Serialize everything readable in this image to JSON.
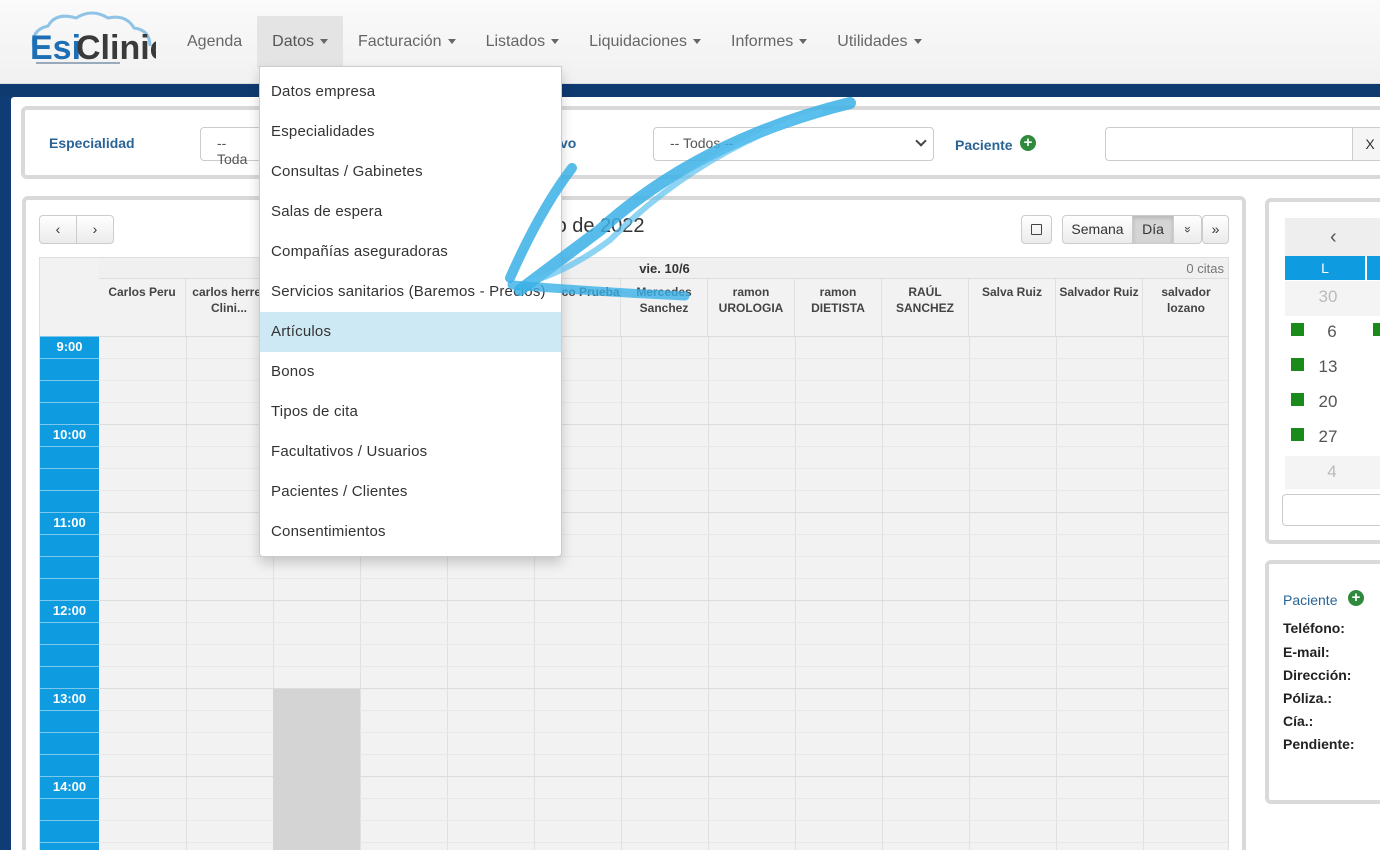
{
  "nav": {
    "items": [
      {
        "label": "Agenda",
        "dropdown": false
      },
      {
        "label": "Datos",
        "dropdown": true
      },
      {
        "label": "Facturación",
        "dropdown": true
      },
      {
        "label": "Listados",
        "dropdown": true
      },
      {
        "label": "Liquidaciones",
        "dropdown": true
      },
      {
        "label": "Informes",
        "dropdown": true
      },
      {
        "label": "Utilidades",
        "dropdown": true
      }
    ],
    "active": "Datos"
  },
  "dropdown": {
    "items": [
      "Datos empresa",
      "Especialidades",
      "Consultas / Gabinetes",
      "Salas de espera",
      "Compañías aseguradoras",
      "Servicios sanitarios (Baremos - Precios)",
      "Artículos",
      "Bonos",
      "Tipos de cita",
      "Facultativos / Usuarios",
      "Pacientes / Clientes",
      "Consentimientos"
    ],
    "highlighted": "Artículos"
  },
  "filters": {
    "especialidad_label": "Especialidad",
    "especialidad_value": "-- Toda",
    "motivo_label_partial": "vo",
    "motivo_value": "-- Todos --",
    "paciente_label": "Paciente",
    "clear_button": "X"
  },
  "calendar": {
    "prev": "‹",
    "next": "›",
    "title_partial": "nio de 2022",
    "note_icon": "note-icon",
    "view_week": "Semana",
    "view_day": "Día",
    "more": "»",
    "expand": "»",
    "day_header": "vie. 10/6",
    "count": "0 citas",
    "columns": [
      "Carlos Peru",
      "carlos herrer Clini...",
      "",
      "",
      "",
      "Medico Prueba",
      "Mercedes Sanchez",
      "ramon UROLOGIA",
      "ramon DIETISTA",
      "RAÚL SANCHEZ",
      "Salva Ruiz",
      "Salvador Ruiz",
      "salvador lozano"
    ],
    "times": [
      "9:00",
      "10:00",
      "11:00",
      "12:00",
      "13:00",
      "14:00"
    ]
  },
  "mini_cal": {
    "prev": "‹",
    "weekday": "L",
    "days": [
      "30",
      "6",
      "13",
      "20",
      "27",
      "4"
    ]
  },
  "patient": {
    "title": "Paciente",
    "fields": [
      "Teléfono:",
      "E-mail:",
      "Dirección:",
      "Póliza.:",
      "Cía.:",
      "Pendiente:"
    ]
  },
  "colors": {
    "accent": "#0e9be0",
    "brand": "#2a6496",
    "navy": "#0f3c74",
    "green": "#2e8b3e"
  }
}
